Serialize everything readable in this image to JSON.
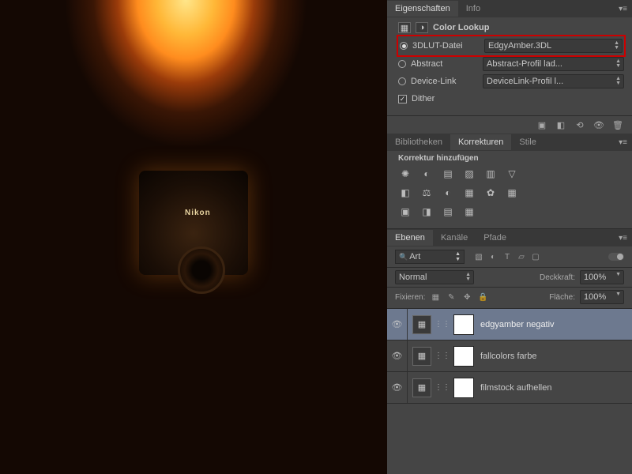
{
  "canvas": {
    "brand": "Nikon"
  },
  "propsPanel": {
    "tabs": {
      "properties": "Eigenschaften",
      "info": "Info"
    },
    "title": "Color Lookup",
    "rows": {
      "lut3d": {
        "label": "3DLUT-Datei",
        "value": "EdgyAmber.3DL"
      },
      "abstract": {
        "label": "Abstract",
        "value": "Abstract-Profil lad..."
      },
      "devicelink": {
        "label": "Device-Link",
        "value": "DeviceLink-Profil l..."
      },
      "dither": {
        "label": "Dither"
      }
    }
  },
  "corrections": {
    "tabs": {
      "lib": "Bibliotheken",
      "corr": "Korrekturen",
      "styles": "Stile"
    },
    "subheader": "Korrektur hinzufügen",
    "row1": [
      "✺",
      "◐",
      "▤",
      "▨",
      "▥",
      "▽"
    ],
    "row2": [
      "◧",
      "⚖",
      "◐",
      "▦",
      "✿",
      "▦"
    ],
    "row3": [
      "▣",
      "◨",
      "▤",
      "▦"
    ]
  },
  "layers": {
    "tabs": {
      "layers": "Ebenen",
      "channels": "Kanäle",
      "paths": "Pfade"
    },
    "searchMode": "Art",
    "blendMode": "Normal",
    "opacityLabel": "Deckkraft:",
    "opacityValue": "100%",
    "lockLabel": "Fixieren:",
    "fillLabel": "Fläche:",
    "fillValue": "100%",
    "items": [
      {
        "name": "edgyamber negativ",
        "selected": true
      },
      {
        "name": "fallcolors farbe",
        "selected": false
      },
      {
        "name": "filmstock aufhellen",
        "selected": false
      }
    ]
  }
}
